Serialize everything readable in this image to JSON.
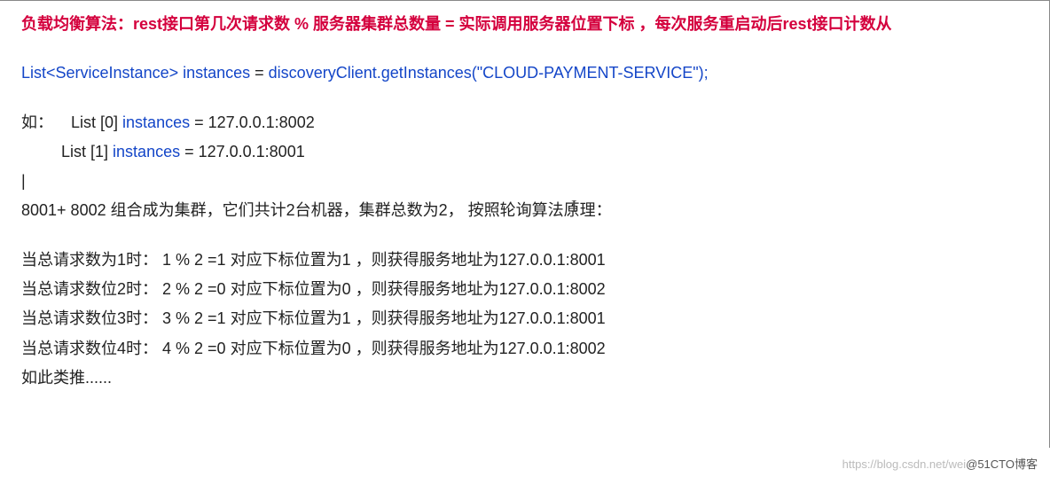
{
  "title": "负载均衡算法：rest接口第几次请求数 % 服务器集群总数量 = 实际调用服务器位置下标 ，每次服务重启动后rest接口计数从",
  "code": {
    "decl_prefix": "List<ServiceInstance> ",
    "var": "instances",
    "assign": " = ",
    "call": "discoveryClient.getInstances(\"CLOUD-PAYMENT-SERVICE\");"
  },
  "example": {
    "label": "如：",
    "line0_prefix": "List [0] ",
    "line0_var": "instances",
    "line0_rest": " = 127.0.0.1:8002",
    "line1_prefix": "List [1] ",
    "line1_var": "instances",
    "line1_rest": " = 127.0.0.1:8001"
  },
  "cursor_line": "|",
  "cluster_text": "8001+ 8002 组合成为集群，它们共计2台机器，集群总数为2， 按照轮询算法原理：",
  "cases": [
    "当总请求数为1时： 1 % 2 =1 对应下标位置为1 ，则获得服务地址为127.0.0.1:8001",
    "当总请求数位2时： 2 % 2 =0 对应下标位置为0 ，则获得服务地址为127.0.0.1:8002",
    "当总请求数位3时： 3 % 2 =1 对应下标位置为1 ，则获得服务地址为127.0.0.1:8001",
    "当总请求数位4时： 4 % 2 =0 对应下标位置为0 ，则获得服务地址为127.0.0.1:8002"
  ],
  "tail": "如此类推......",
  "watermark_faint": "https://blog.csdn.net/wei",
  "watermark_dark": "@51CTO博客"
}
